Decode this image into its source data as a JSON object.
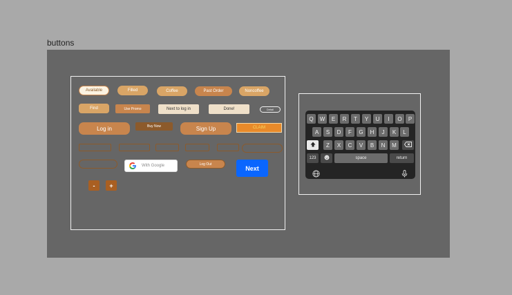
{
  "frame": {
    "title": "buttons"
  },
  "buttons": {
    "available": "Available",
    "filled": "Filled",
    "coffee": "Coffee",
    "past_order": "Past Order",
    "noncoffee": "Noncoffee",
    "find": "Find",
    "use_promo": "Use Promo",
    "next_to_log_in": "Next to log in",
    "done": "Done!",
    "detail": "Detail",
    "log_in": "Log in",
    "buy_now": "Buy Now",
    "sign_up": "Sign Up",
    "claim": "CLAIM",
    "with_google": "With Google",
    "log_out": "Log Out",
    "next": "Next",
    "minus": "-",
    "plus": "+"
  },
  "keyboard": {
    "row1": [
      "Q",
      "W",
      "E",
      "R",
      "T",
      "Y",
      "U",
      "I",
      "O",
      "P"
    ],
    "row2": [
      "A",
      "S",
      "D",
      "F",
      "G",
      "H",
      "J",
      "K",
      "L"
    ],
    "row3": [
      "Z",
      "X",
      "C",
      "V",
      "B",
      "N",
      "M"
    ],
    "numbers": "123",
    "space": "space",
    "return": "return"
  },
  "colors": {
    "page_bg": "#a9a9a9",
    "canvas_bg": "#666666",
    "tan": "#d9a566",
    "brown": "#c8854d",
    "dark_brown": "#8c5a2b",
    "cream": "#efe0c9",
    "claim_orange": "#e88a2a",
    "next_blue": "#0a66ff",
    "keyboard_bg": "#242424"
  },
  "icons": [
    "google-g-icon",
    "shift-icon",
    "backspace-icon",
    "emoji-icon",
    "globe-icon",
    "microphone-icon"
  ]
}
